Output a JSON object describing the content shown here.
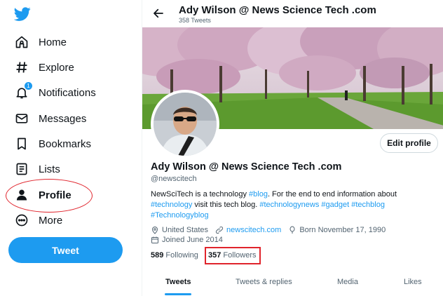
{
  "sidebar": {
    "items": [
      {
        "label": "Home",
        "icon": "home-icon"
      },
      {
        "label": "Explore",
        "icon": "hashtag-icon"
      },
      {
        "label": "Notifications",
        "icon": "bell-icon",
        "badge": "1"
      },
      {
        "label": "Messages",
        "icon": "envelope-icon"
      },
      {
        "label": "Bookmarks",
        "icon": "bookmark-icon"
      },
      {
        "label": "Lists",
        "icon": "list-icon"
      },
      {
        "label": "Profile",
        "icon": "person-icon",
        "active": true
      },
      {
        "label": "More",
        "icon": "more-icon"
      }
    ],
    "tweet_label": "Tweet"
  },
  "header": {
    "title": "Ady Wilson @ News Science Tech .com",
    "tweet_count": "358 Tweets"
  },
  "profile": {
    "edit_label": "Edit profile",
    "name": "Ady Wilson @ News Science Tech .com",
    "handle": "@newscitech",
    "bio": {
      "p1": "NewSciTech is a technology ",
      "t1": "#blog",
      "p2": ". For the end to end information about ",
      "t2": "#technology",
      "p3": " visit this tech blog.  ",
      "t3": "#technologynews",
      "t4": "#gadget",
      "t5": "#techblog",
      "t6": "#Technologyblog"
    },
    "location": "United States",
    "website": "newscitech.com",
    "born": "Born November 17, 1990",
    "joined": "Joined June 2014",
    "following_count": "589",
    "following_label": "Following",
    "followers_count": "357",
    "followers_label": "Followers"
  },
  "tabs": [
    "Tweets",
    "Tweets & replies",
    "Media",
    "Likes"
  ],
  "colors": {
    "accent": "#1d9bf0",
    "highlight": "#e0242c"
  }
}
